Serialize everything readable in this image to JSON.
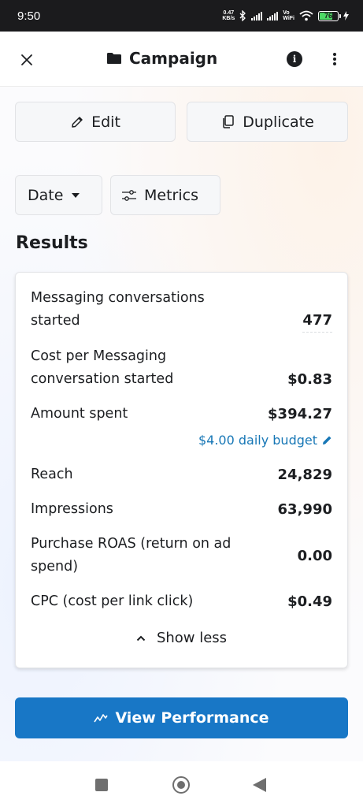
{
  "status_bar": {
    "time": "9:50",
    "net_speed_value": "0.47",
    "net_speed_unit": "KB/s",
    "network_type_top": "Vo",
    "network_type_bottom": "WiFi",
    "battery": "76"
  },
  "header": {
    "title": "Campaign"
  },
  "actions": {
    "edit_label": "Edit",
    "duplicate_label": "Duplicate"
  },
  "filters": {
    "date_label": "Date",
    "metrics_label": "Metrics"
  },
  "results": {
    "title": "Results",
    "rows": [
      {
        "label": "Messaging conversations started",
        "value": "477"
      },
      {
        "label": "Cost per Messaging conversation started",
        "value": "$0.83"
      },
      {
        "label": "Amount spent",
        "value": "$394.27"
      },
      {
        "label": "Reach",
        "value": "24,829"
      },
      {
        "label": "Impressions",
        "value": "63,990"
      },
      {
        "label": "Purchase ROAS (return on ad spend)",
        "value": "0.00"
      },
      {
        "label": "CPC (cost per link click)",
        "value": "$0.49"
      }
    ],
    "budget_link": "$4.00 daily budget",
    "show_less": "Show less"
  },
  "view_performance_label": "View Performance",
  "colors": {
    "accent": "#1877c6",
    "link": "#1777b6",
    "battery": "#4cd964"
  },
  "icons": [
    "close-icon",
    "folder-icon",
    "info-icon",
    "more-vertical-icon",
    "pencil-icon",
    "copy-icon",
    "caret-down-icon",
    "sliders-icon",
    "chevron-up-icon",
    "trend-line-icon"
  ]
}
